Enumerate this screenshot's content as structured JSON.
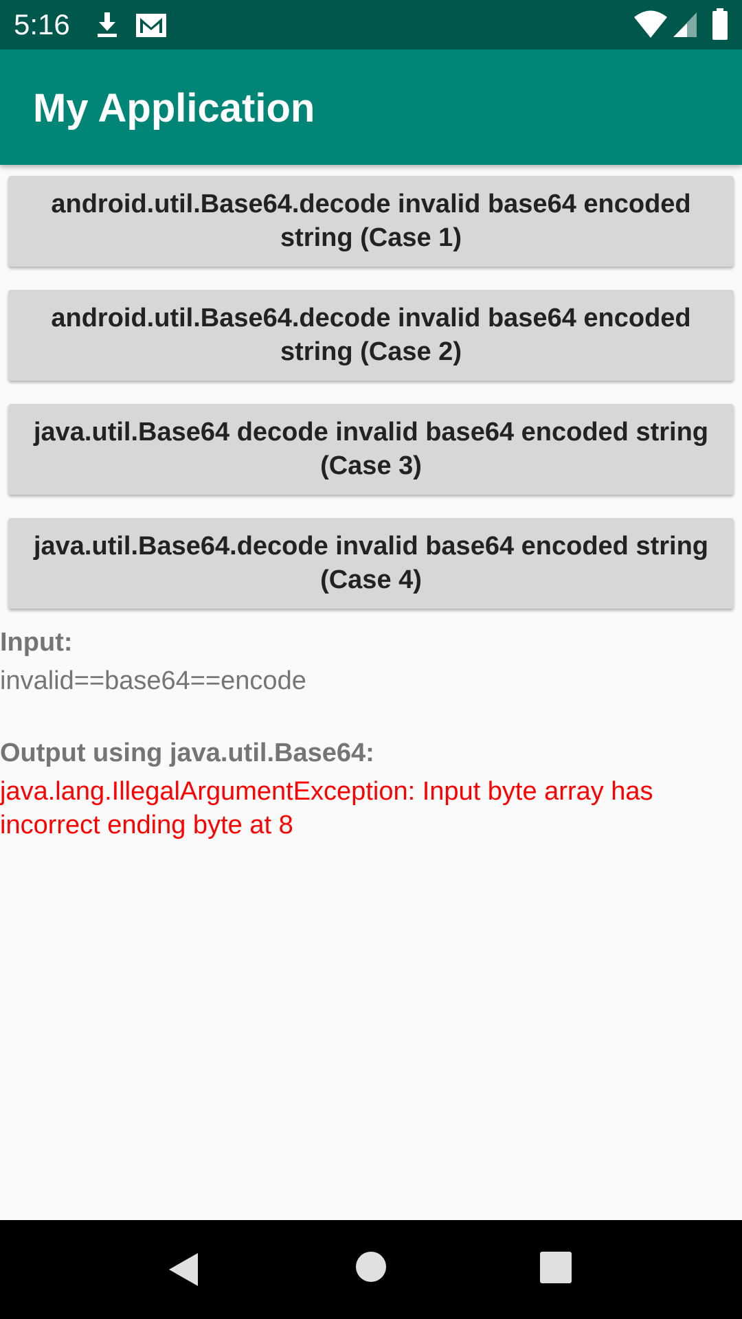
{
  "status_bar": {
    "time": "5:16",
    "icons": [
      "download-icon",
      "gmail-icon",
      "wifi-icon",
      "signal-icon",
      "battery-icon"
    ],
    "background": "#00574b"
  },
  "app_bar": {
    "title": "My Application",
    "background": "#008577"
  },
  "buttons": [
    {
      "label": "android.util.Base64.decode invalid base64 encoded string (Case 1)"
    },
    {
      "label": "android.util.Base64.decode invalid base64 encoded string (Case 2)"
    },
    {
      "label": "java.util.Base64 decode invalid base64 encoded string (Case 3)"
    },
    {
      "label": "java.util.Base64.decode invalid base64 encoded string (Case 4)"
    }
  ],
  "result": {
    "input_label": "Input:",
    "input_value": "invalid==base64==encode",
    "output_label": "Output using java.util.Base64:",
    "output_value": "java.lang.IllegalArgumentException: Input byte array has incorrect ending byte at 8",
    "error_color": "#ff0000"
  },
  "nav_bar": {
    "icons": [
      "back-icon",
      "home-icon",
      "recents-icon"
    ]
  }
}
